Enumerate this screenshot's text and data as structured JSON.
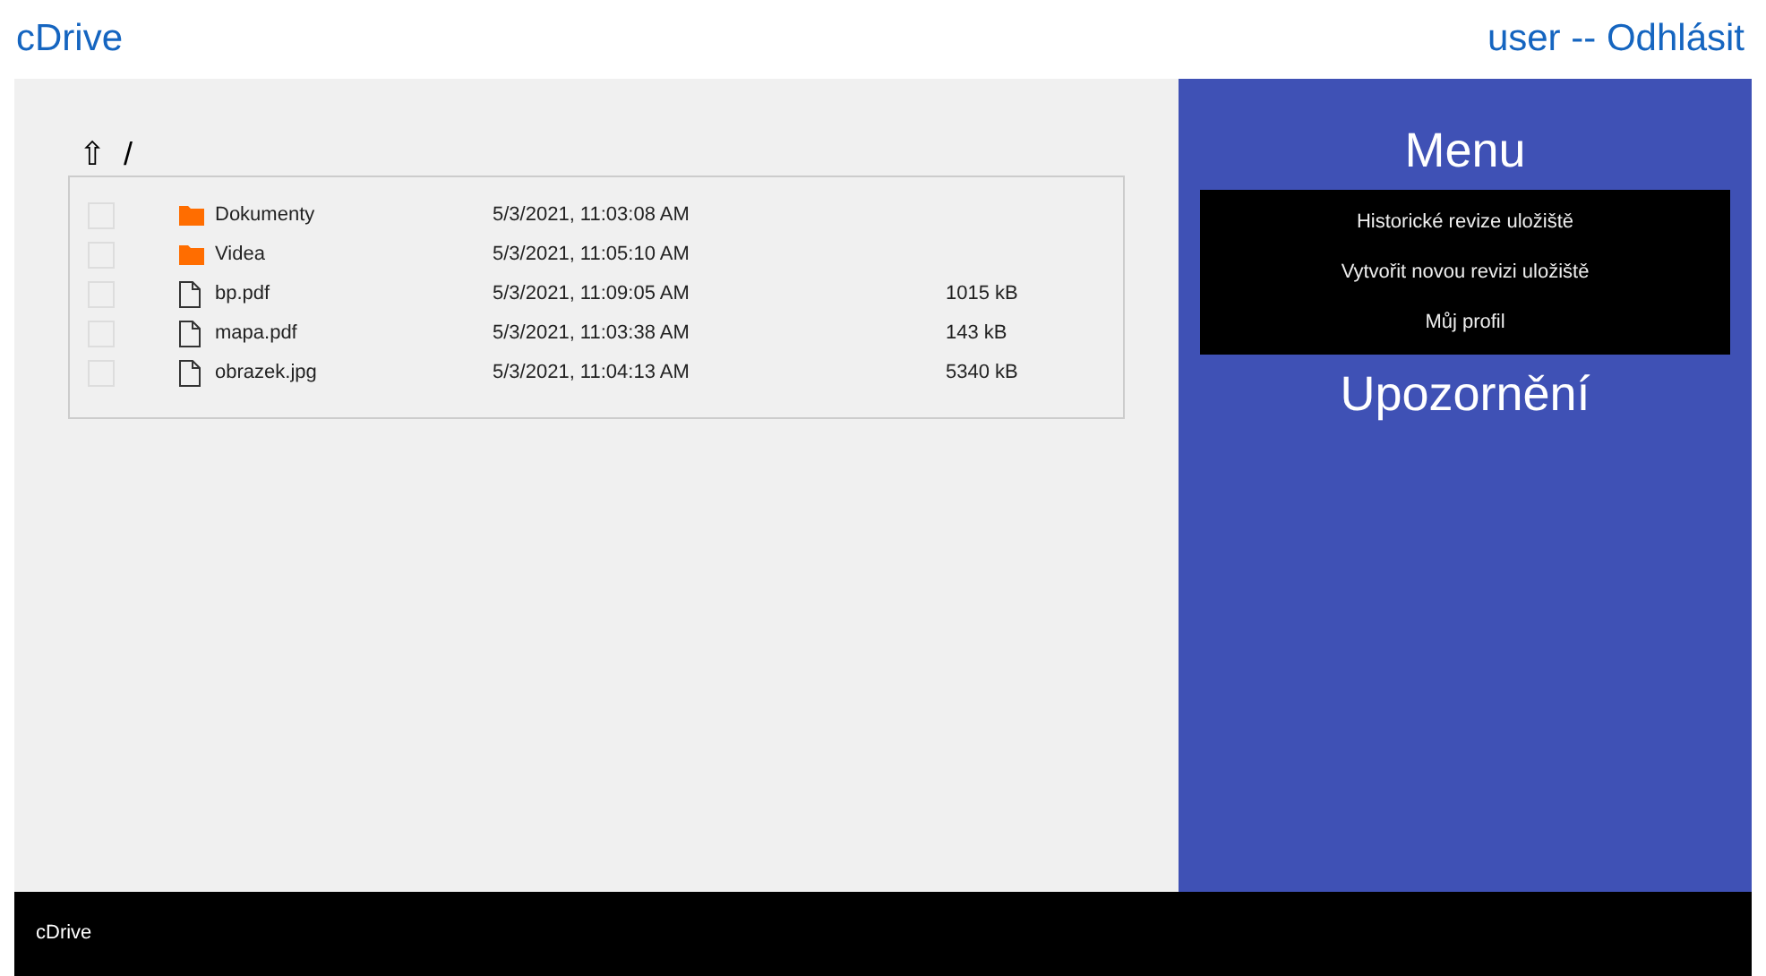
{
  "header": {
    "brand": "cDrive",
    "user_link": "user -- Odhlásit"
  },
  "browser": {
    "up_button": "⇧",
    "path": "/",
    "files": [
      {
        "kind": "folder",
        "checked": false,
        "name": "Dokumenty",
        "modified": "5/3/2021, 11:03:08 AM"
      },
      {
        "kind": "folder",
        "checked": false,
        "name": "Videa",
        "modified": "5/3/2021, 11:05:10 AM"
      },
      {
        "kind": "file",
        "checked": false,
        "name": "bp.pdf",
        "modified": "5/3/2021, 11:09:05 AM",
        "size": "1015 kB"
      },
      {
        "kind": "file",
        "checked": false,
        "name": "mapa.pdf",
        "modified": "5/3/2021, 11:03:38 AM",
        "size": "143 kB"
      },
      {
        "kind": "file",
        "checked": false,
        "name": "obrazek.jpg",
        "modified": "5/3/2021, 11:04:13 AM",
        "size": "5340 kB"
      }
    ]
  },
  "sidebar": {
    "menu_title": "Menu",
    "menu_items": [
      "Historické revize uložiště",
      "Vytvořit novou revizi uložiště",
      "Můj profil"
    ],
    "notifications_title": "Upozornění"
  },
  "footer": {
    "text": "cDrive"
  }
}
